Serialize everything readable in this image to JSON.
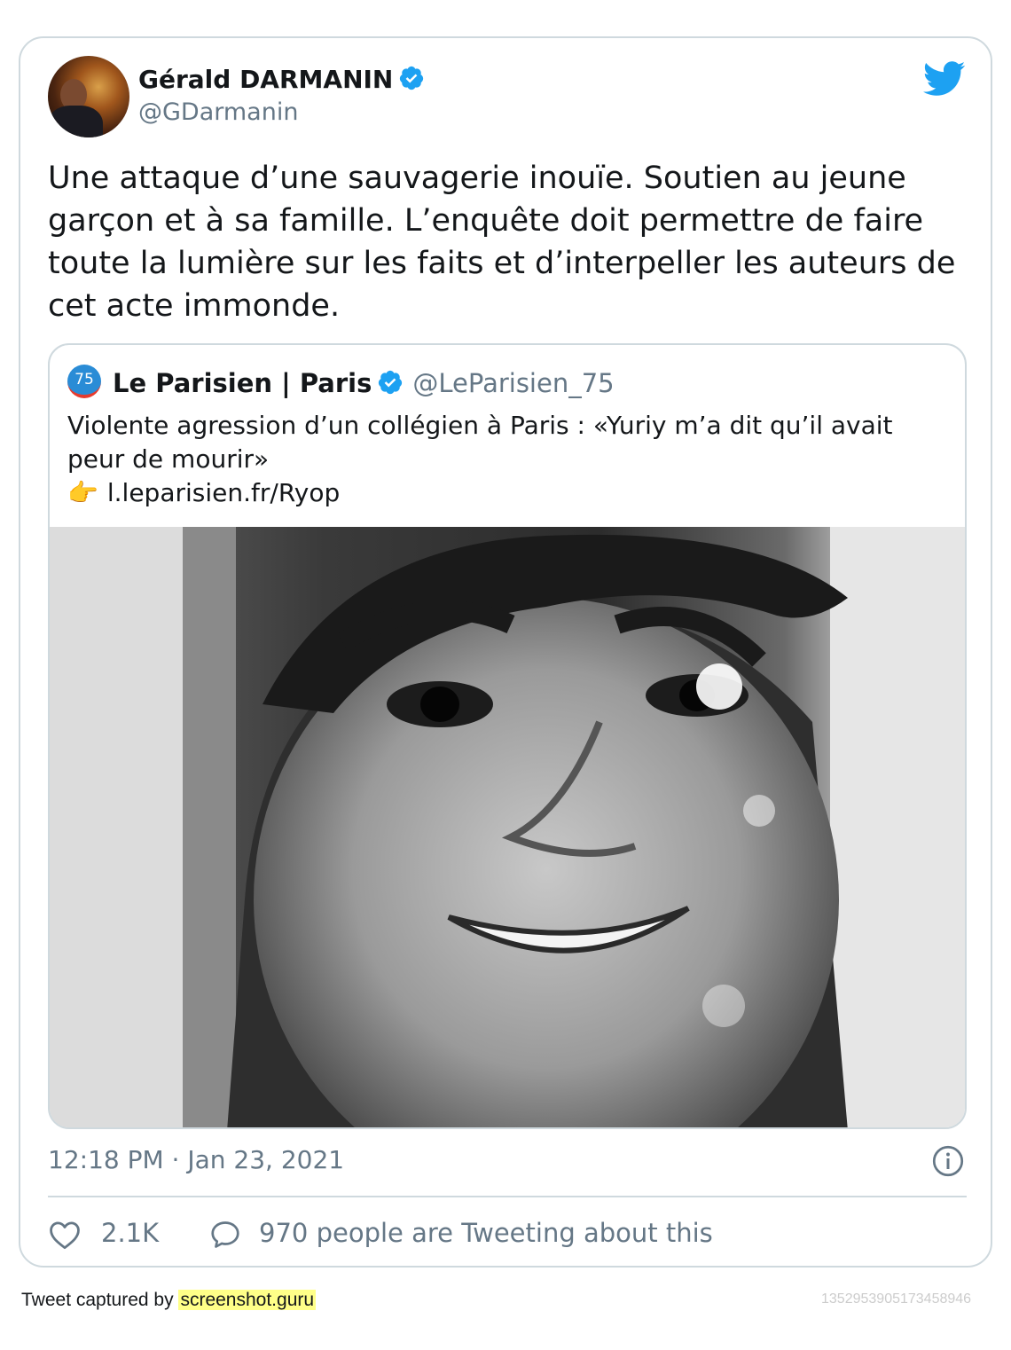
{
  "tweet": {
    "author_name": "Gérald DARMANIN",
    "author_handle": "@GDarmanin",
    "text": "Une attaque d’une sauvagerie inouïe. Soutien au jeune garçon et à sa famille. L’enquête doit permettre de faire toute la lumière sur les faits et d’interpeller les auteurs de cet acte immonde.",
    "timestamp": "12:18 PM · Jan 23, 2021",
    "likes": "2.1K",
    "tweeting_about": "970 people are Tweeting about this"
  },
  "quoted": {
    "avatar_text": "75",
    "name": "Le Parisien | Paris",
    "handle": "@LeParisien_75",
    "text": "Violente agression d’un collégien à Paris : «Yuriy m’a dit qu’il avait peur de mourir»",
    "link_emoji": "👉",
    "link": "l.leparisien.fr/Ryop"
  },
  "footer": {
    "captured_by": "Tweet captured by",
    "brand": "screenshot.guru",
    "tweet_id": "1352953905173458946"
  },
  "colors": {
    "twitter_blue": "#1da1f2",
    "text_primary": "#14171a",
    "text_secondary": "#657786",
    "border": "#cfd9de",
    "highlight": "#ffff88"
  },
  "icons": {
    "verified": "verified-badge-icon",
    "twitter": "twitter-bird-icon",
    "info": "info-icon",
    "like": "heart-icon",
    "reply": "speech-bubble-icon"
  }
}
